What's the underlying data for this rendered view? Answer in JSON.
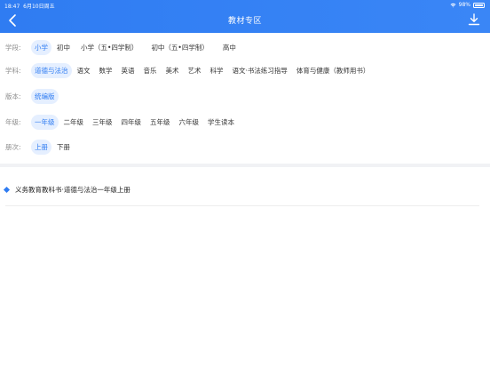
{
  "status": {
    "time": "18:47",
    "date": "6月10日周五",
    "battery": "98%"
  },
  "header": {
    "title": "教材专区"
  },
  "filters": {
    "stage": {
      "label": "学段:",
      "options": [
        "小学",
        "初中",
        "小学（五•四学制）",
        "初中（五•四学制）",
        "高中"
      ],
      "selected": "小学"
    },
    "subject": {
      "label": "学科:",
      "options": [
        "道德与法治",
        "语文",
        "数学",
        "英语",
        "音乐",
        "美术",
        "艺术",
        "科学",
        "语文·书法练习指导",
        "体育与健康（教师用书）"
      ],
      "selected": "道德与法治"
    },
    "edition": {
      "label": "版本:",
      "options": [
        "统编版"
      ],
      "selected": "统编版"
    },
    "grade": {
      "label": "年级:",
      "options": [
        "一年级",
        "二年级",
        "三年级",
        "四年级",
        "五年级",
        "六年级",
        "学生读本"
      ],
      "selected": "一年级"
    },
    "volume": {
      "label": "册次:",
      "options": [
        "上册",
        "下册"
      ],
      "selected": "上册"
    }
  },
  "books": [
    {
      "title": "义务教育教科书·道德与法治一年级上册"
    }
  ],
  "colors": {
    "accent": "#2f7cf2",
    "selected_bg": "#e5efff"
  }
}
